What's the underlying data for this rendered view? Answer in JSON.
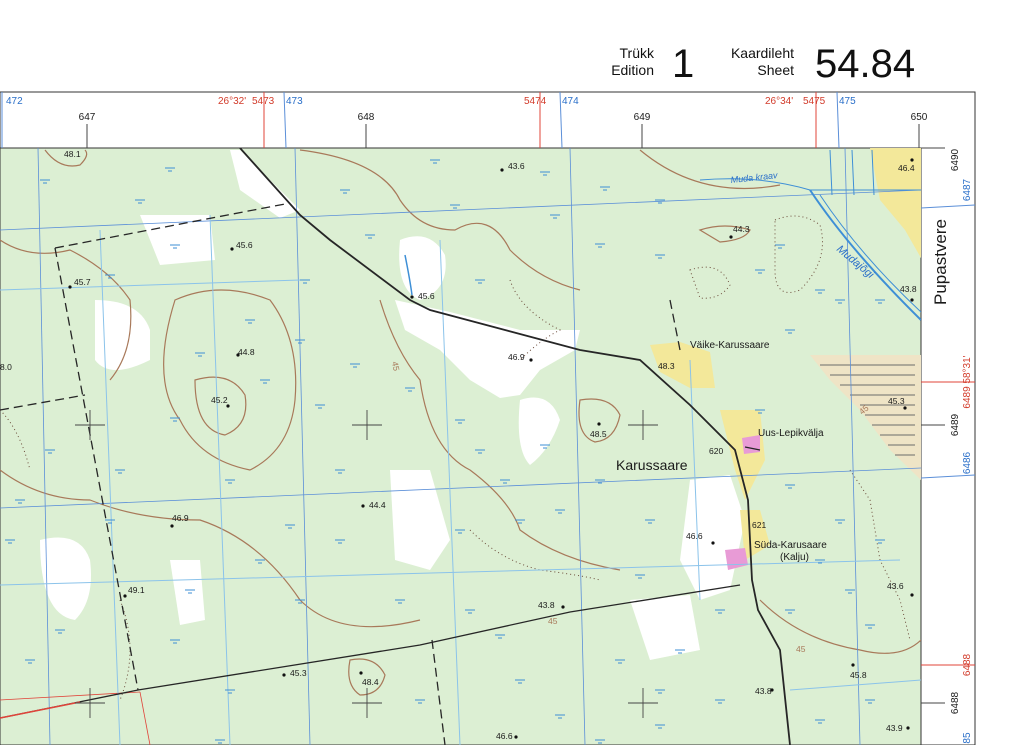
{
  "header": {
    "edition_et": "Trükk",
    "edition_en": "Edition",
    "edition_number": "1",
    "sheet_et": "Kaardileht",
    "sheet_en": "Sheet",
    "sheet_number": "54.84"
  },
  "margin_top": {
    "km_labels": [
      "647",
      "648",
      "649",
      "650"
    ],
    "blue_labels": [
      "472",
      "473",
      "474",
      "475"
    ],
    "red_labels": [
      "5473",
      "5474",
      "5475"
    ],
    "geo_labels": [
      "26°32'",
      "26°34'"
    ]
  },
  "margin_right": {
    "km_labels": [
      "6490",
      "6489",
      "6488"
    ],
    "blue_labels": [
      "6487",
      "6486",
      "85"
    ],
    "red_labels": [
      "6489 58°31'",
      "6488"
    ],
    "village": "Pupastvere"
  },
  "places": {
    "karussaare": "Karussaare",
    "vaike": "Väike-Karussaare",
    "uus": "Uus-Lepikvälja",
    "suda": "Süda-Karusaare",
    "kalju": "(Kalju)"
  },
  "water": {
    "muda_kraav": "Muda kraav",
    "mudajogi": "Mudajõgi"
  },
  "elevations": [
    "48.1",
    "43.6",
    "46.4",
    "45.6",
    "44.3",
    "45.7",
    "45.6",
    "43.8",
    "44.8",
    "46.9",
    "48.3",
    "8.0",
    "45.2",
    "48.5",
    "45.3",
    "46.9",
    "44.4",
    "46.6",
    "49.1",
    "43.8",
    "43.6",
    "45.3",
    "48.4",
    "45.8",
    "43.8",
    "43.9",
    "46.6"
  ],
  "contours": [
    "45",
    "45",
    "45",
    "45"
  ],
  "road_numbers": [
    "620",
    "621"
  ],
  "colors": {
    "map_bg": "#dcefd3",
    "open_area": "#ffffff",
    "grid_blue": "#5b8fd8",
    "grid_red": "#e0443a",
    "contour_brown": "#a8795a",
    "road_black": "#262626",
    "water_blue": "#3e8fd6",
    "farm_yellow": "#f3e89a",
    "building_pink": "#e89bd6"
  }
}
